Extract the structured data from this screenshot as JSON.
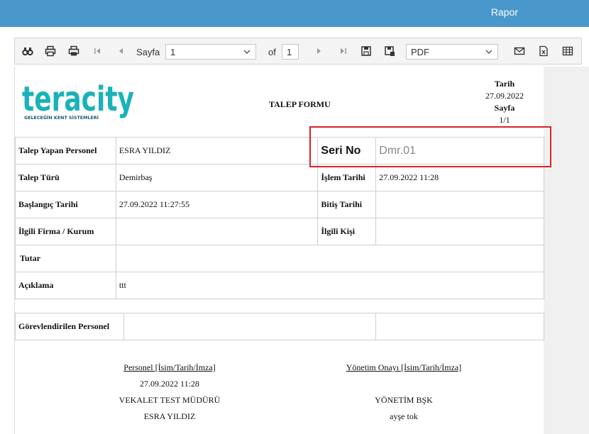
{
  "header": {
    "title": "Rapor"
  },
  "toolbar": {
    "page_label": "Sayfa",
    "page_value": "1",
    "of_label": "of",
    "total_pages": "1",
    "format_value": "PDF",
    "icons": [
      "find-icon",
      "print-icon",
      "print-pdf-icon",
      "first-page-icon",
      "prev-page-icon",
      "next-page-icon",
      "last-page-icon",
      "save-icon",
      "export-icon",
      "email-icon",
      "excel-icon",
      "table-icon"
    ]
  },
  "report": {
    "logo_text": "teracity",
    "logo_tagline": "GELECEĞİN KENT SİSTEMLERİ",
    "form_title": "TALEP FORMU",
    "date_label": "Tarih",
    "date_value": "27.09.2022",
    "page_label": "Sayfa",
    "page_value": "1/1",
    "rows": {
      "requester_label": "Talep Yapan Personel",
      "requester_value": "ESRA YILDIZ",
      "serial_label": "Seri No",
      "serial_value": "Dmr.01",
      "type_label": "Talep Türü",
      "type_value": "Demirbaş",
      "process_date_label": "İşlem Tarihi",
      "process_date_value": "27.09.2022 11:28",
      "start_label": "Başlangıç Tarihi",
      "start_value": "27.09.2022 11:27:55",
      "end_label": "Bitiş Tarihi",
      "end_value": "",
      "company_label": "İlgili Firma / Kurum",
      "company_value": "",
      "contact_label": "İlgili Kişi",
      "contact_value": "",
      "amount_label": "Tutar",
      "amount_value": "",
      "desc_label": "Açıklama",
      "desc_value": "ttt",
      "assigned_label": "Görevlendirilen Personel",
      "assigned_value": ""
    },
    "signature_left": {
      "heading": "Personel [İsim/Tarih/İmza]",
      "date": "27.09.2022 11:28",
      "title": "VEKALET TEST MÜDÜRÜ",
      "name": "ESRA YILDIZ"
    },
    "signature_right": {
      "heading": "Yönetim Onayı [İsim/Tarih/İmza]",
      "title": "YÖNETİM BŞK",
      "name": "ayşe tok"
    }
  },
  "colors": {
    "topbar": "#4a97cc",
    "highlight": "#d8232a",
    "logo": "#1ab2b8"
  }
}
